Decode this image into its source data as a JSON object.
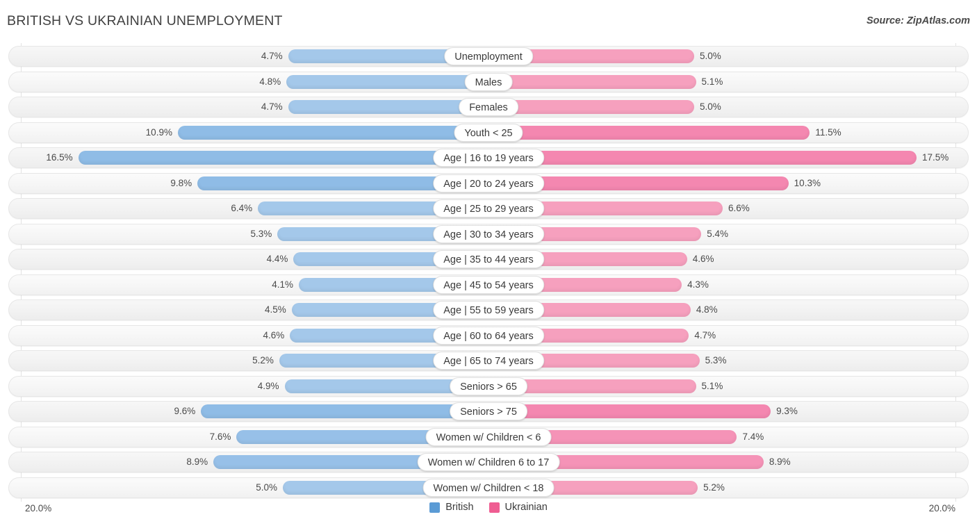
{
  "header": {
    "title": "BRITISH VS UKRAINIAN UNEMPLOYMENT",
    "source": "Source: ZipAtlas.com"
  },
  "axis": {
    "left_label": "20.0%",
    "right_label": "20.0%",
    "max": 20.0,
    "min": 0.0
  },
  "legend": {
    "items": [
      {
        "label": "British",
        "color": "#5b9bd5"
      },
      {
        "label": "Ukrainian",
        "color": "#ef5d92"
      }
    ]
  },
  "chart_data": {
    "type": "bar",
    "subtype": "diverging-bidirectional-bar",
    "title": "BRITISH VS UKRAINIAN UNEMPLOYMENT",
    "xlabel": "",
    "ylabel": "",
    "xlim": [
      20.0,
      20.0
    ],
    "grid": true,
    "legend_position": "bottom-center",
    "categories": [
      "Unemployment",
      "Males",
      "Females",
      "Youth < 25",
      "Age | 16 to 19 years",
      "Age | 20 to 24 years",
      "Age | 25 to 29 years",
      "Age | 30 to 34 years",
      "Age | 35 to 44 years",
      "Age | 45 to 54 years",
      "Age | 55 to 59 years",
      "Age | 60 to 64 years",
      "Age | 65 to 74 years",
      "Seniors > 65",
      "Seniors > 75",
      "Women w/ Children < 6",
      "Women w/ Children 6 to 17",
      "Women w/ Children < 18"
    ],
    "series": [
      {
        "name": "British",
        "color": "#5b9bd5",
        "values": [
          4.7,
          4.8,
          4.7,
          10.9,
          16.5,
          9.8,
          6.4,
          5.3,
          4.4,
          4.1,
          4.5,
          4.6,
          5.2,
          4.9,
          9.6,
          7.6,
          8.9,
          5.0
        ],
        "labels": [
          "4.7%",
          "4.8%",
          "4.7%",
          "10.9%",
          "16.5%",
          "9.8%",
          "6.4%",
          "5.3%",
          "4.4%",
          "4.1%",
          "4.5%",
          "4.6%",
          "5.2%",
          "4.9%",
          "9.6%",
          "7.6%",
          "8.9%",
          "5.0%"
        ]
      },
      {
        "name": "Ukrainian",
        "color": "#ef5d92",
        "values": [
          5.0,
          5.1,
          5.0,
          11.5,
          17.5,
          10.3,
          6.6,
          5.4,
          4.6,
          4.3,
          4.8,
          4.7,
          5.3,
          5.1,
          9.3,
          7.4,
          8.9,
          5.2
        ],
        "labels": [
          "5.0%",
          "5.1%",
          "5.0%",
          "11.5%",
          "17.5%",
          "10.3%",
          "6.6%",
          "5.4%",
          "4.6%",
          "4.3%",
          "4.8%",
          "4.7%",
          "5.3%",
          "5.1%",
          "9.3%",
          "7.4%",
          "8.9%",
          "5.2%"
        ]
      }
    ]
  }
}
